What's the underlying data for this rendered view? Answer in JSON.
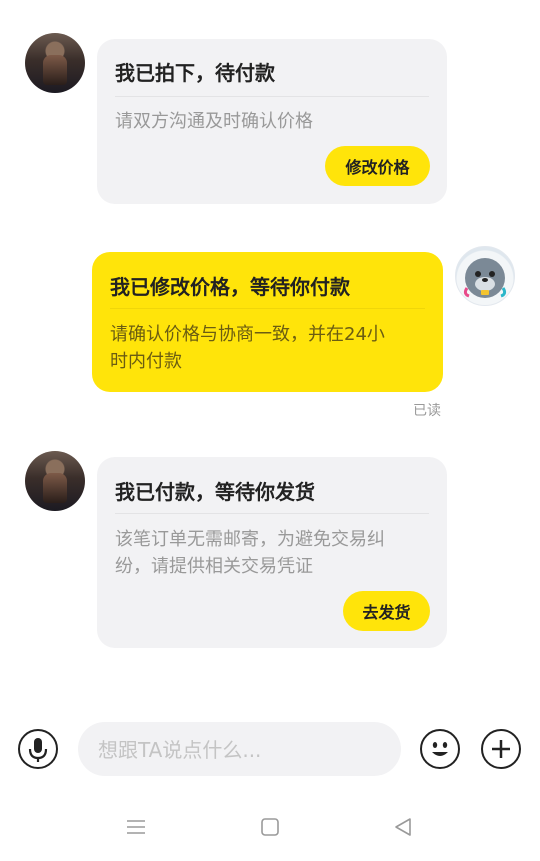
{
  "messages": [
    {
      "side": "left",
      "title": "我已拍下，待付款",
      "body": "请双方沟通及时确认价格",
      "action": "修改价格"
    },
    {
      "side": "right",
      "title": "我已修改价格，等待你付款",
      "body_line1": "请确认价格与协商一致，并在24小",
      "body_line2": "时内付款",
      "status": "已读"
    },
    {
      "side": "left",
      "title": "我已付款，等待你发货",
      "body_line1": "该笔订单无需邮寄，为避免交易纠",
      "body_line2": "纷，请提供相关交易凭证",
      "action": "去发货"
    }
  ],
  "composer": {
    "placeholder": "想跟TA说点什么...",
    "voice_icon": "microphone-icon",
    "emoji_icon": "emoji-icon",
    "more_icon": "plus-icon"
  },
  "nav": {
    "menu_icon": "menu-icon",
    "home_icon": "home-square-icon",
    "back_icon": "back-triangle-icon"
  },
  "colors": {
    "accent_yellow": "#ffe40a",
    "bubble_grey": "#f2f2f4"
  }
}
